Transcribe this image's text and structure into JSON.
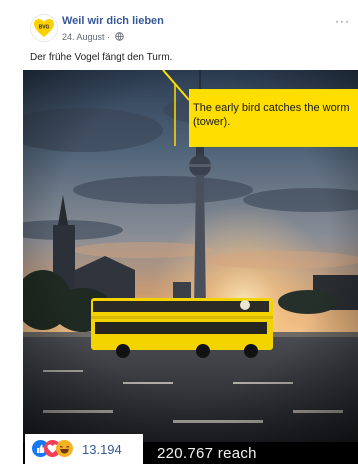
{
  "post": {
    "page_name": "Weil wir dich lieben",
    "date": "24. August · ",
    "caption": "Der frühe Vogel fängt den Turm.",
    "more_label": "···"
  },
  "overlay": {
    "tooltip_line1": "The early bird catches the worm",
    "tooltip_line2": "(tower)."
  },
  "stats": {
    "reaction_count": "13.194",
    "reach": "220.767 reach"
  },
  "icons": {
    "avatar": "bvg-heart-logo",
    "visibility": "globe-icon",
    "reactions": [
      "like-icon",
      "love-icon",
      "haha-icon"
    ]
  },
  "colors": {
    "page_link": "#365899",
    "tooltip": "#ffde00",
    "bus": "#f4d400",
    "like": "#1877f2",
    "love": "#f33e58",
    "haha": "#f7b125"
  }
}
